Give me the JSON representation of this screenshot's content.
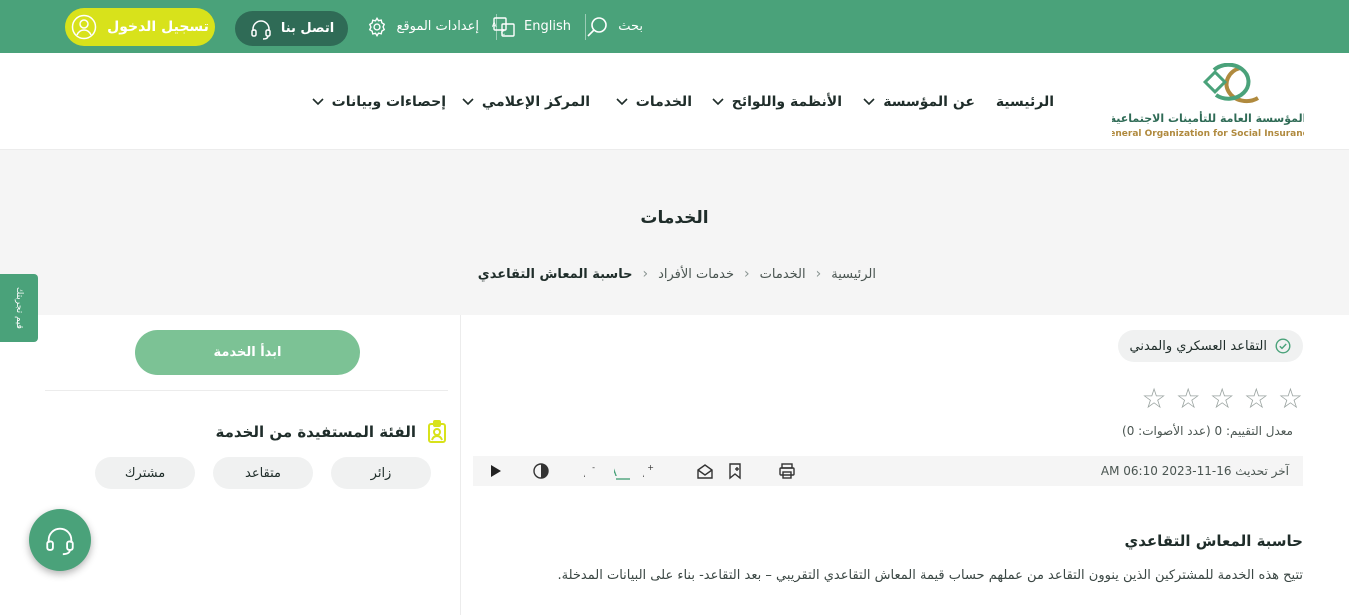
{
  "topbar": {
    "search_label": "بحث",
    "language_label": "English",
    "settings_label": "إعدادات الموقع",
    "contact_label": "اتصل بنا",
    "login_label": "تسجيل الدخول"
  },
  "logo": {
    "arabic_name": "المؤسسة العامة للتأمينات الاجتماعية",
    "english_name": "General Organization for Social Insurance"
  },
  "nav": {
    "items": [
      {
        "label": "الرئيسية",
        "has_dropdown": false
      },
      {
        "label": "عن المؤسسة",
        "has_dropdown": true
      },
      {
        "label": "الأنظمة واللوائح",
        "has_dropdown": true
      },
      {
        "label": "الخدمات",
        "has_dropdown": true
      },
      {
        "label": "المركز الإعلامي",
        "has_dropdown": true
      },
      {
        "label": "إحصاءات وبيانات",
        "has_dropdown": true
      }
    ]
  },
  "hero": {
    "title": "الخدمات",
    "breadcrumb": [
      "الرئيسية",
      "الخدمات",
      "خدمات الأفراد",
      "حاسبة المعاش التقاعدي"
    ]
  },
  "feedback_tab": "قيم تجربتك",
  "service": {
    "tag": "التقاعد العسكري والمدني",
    "rating": {
      "stars_total": 5,
      "stars_filled": 0,
      "text": "معدل التقييم: 0 (عدد الأصوات: 0)"
    },
    "last_updated": "آخر تحديث 16-11-2023 06:10 AM",
    "title": "حاسبة المعاش التقاعدي",
    "description": "تتيح هذه الخدمة للمشتركين الذين ينوون التقاعد من عملهم حساب قيمة المعاش التقاعدي التقريبي – بعد التقاعد- بناء على البيانات المدخلة."
  },
  "sidebar": {
    "start_button": "ابدأ الخدمة",
    "beneficiaries_title": "الفئة المستفيدة من الخدمة",
    "beneficiaries": [
      "زائر",
      "متقاعد",
      "مشترك"
    ]
  },
  "colors": {
    "primary_green": "#4aa27a",
    "dark_green": "#2f6b56",
    "login_yellow": "#d8e21b",
    "start_button": "#7cc295",
    "logo_gold": "#b08a3e"
  }
}
